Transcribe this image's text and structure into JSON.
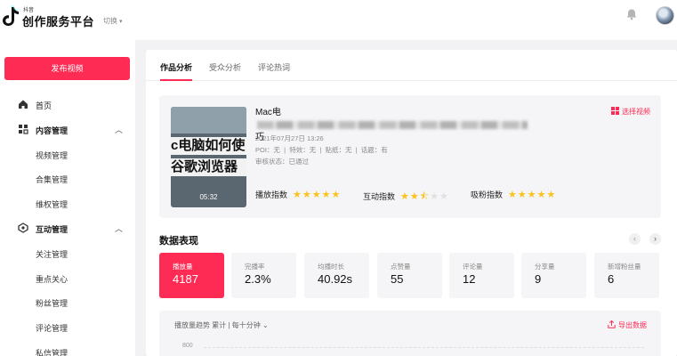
{
  "header": {
    "brand_sub": "抖音",
    "brand": "创作服务平台",
    "switch_label": "切换"
  },
  "sidebar": {
    "publish_label": "发布视频",
    "items": [
      {
        "label": "首页",
        "type": "top",
        "icon": "home-icon"
      },
      {
        "label": "内容管理",
        "type": "group",
        "icon": "grid-icon"
      },
      {
        "label": "视频管理",
        "type": "sub"
      },
      {
        "label": "合集管理",
        "type": "sub"
      },
      {
        "label": "维权管理",
        "type": "sub"
      },
      {
        "label": "互动管理",
        "type": "group",
        "icon": "interaction-icon"
      },
      {
        "label": "关注管理",
        "type": "sub"
      },
      {
        "label": "重点关心",
        "type": "sub"
      },
      {
        "label": "粉丝管理",
        "type": "sub"
      },
      {
        "label": "评论管理",
        "type": "sub"
      },
      {
        "label": "私信管理",
        "type": "sub"
      }
    ]
  },
  "tabs": [
    "作品分析",
    "受众分析",
    "评论热词"
  ],
  "video": {
    "title_prefix": "Mac电",
    "title_suffix": "巧",
    "thumb_line1": "c电脑如何使",
    "thumb_line2": "谷歌浏览器",
    "duration": "05:32",
    "date": "2021年07月27日 13:26",
    "meta_line": "POI：无  |  特效：无  |  贴纸：无  |  话题：有",
    "review": "审核状态：已通过",
    "select_label": "选择视频",
    "ratings": [
      {
        "label": "播放指数",
        "stars": 5
      },
      {
        "label": "互动指数",
        "stars": 2.5
      },
      {
        "label": "吸粉指数",
        "stars": 5
      }
    ]
  },
  "performance": {
    "title": "数据表现",
    "metrics": [
      {
        "label": "播放量",
        "value": "4187",
        "active": true
      },
      {
        "label": "完播率",
        "value": "2.3%"
      },
      {
        "label": "均播时长",
        "value": "40.92s"
      },
      {
        "label": "点赞量",
        "value": "55"
      },
      {
        "label": "评论量",
        "value": "12"
      },
      {
        "label": "分享量",
        "value": "9"
      },
      {
        "label": "新增粉丝量",
        "value": "6"
      }
    ]
  },
  "trend": {
    "label": "播放量趋势  累计 | 每十分钟 ⌄",
    "export_label": "导出数据",
    "ytick": "800"
  },
  "colors": {
    "accent": "#fe2c55",
    "star": "#fcc21b"
  }
}
